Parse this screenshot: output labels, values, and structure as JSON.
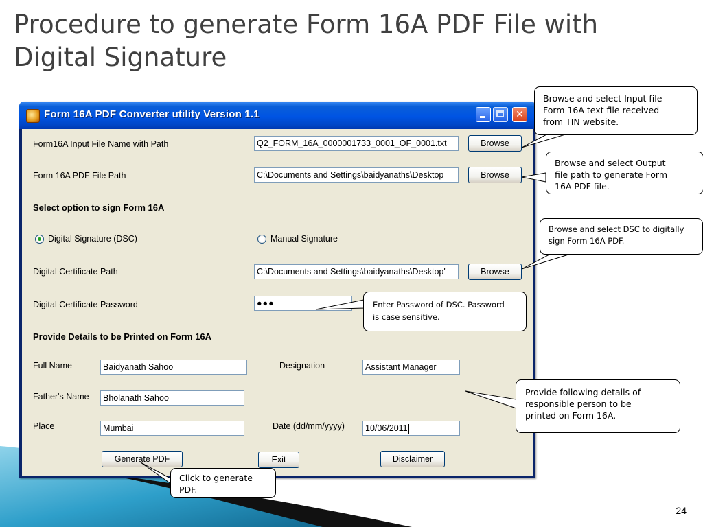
{
  "slide": {
    "title": "Procedure to generate Form 16A PDF File with Digital Signature",
    "page_number": "24"
  },
  "window": {
    "title": "Form 16A PDF Converter utility Version 1.1",
    "input_file": {
      "label": "Form16A Input File Name with Path",
      "value": "Q2_FORM_16A_0000001733_0001_OF_0001.txt",
      "browse": "Browse"
    },
    "pdf_path": {
      "label": "Form 16A PDF File Path",
      "value": "C:\\Documents and Settings\\baidyanaths\\Desktop",
      "browse": "Browse"
    },
    "sign_section": {
      "heading": "Select option to sign Form 16A",
      "option_dsc": "Digital Signature (DSC)",
      "option_manual": "Manual Signature",
      "selected": "Digital Signature (DSC)"
    },
    "cert_path": {
      "label": "Digital Certificate Path",
      "value": "C:\\Documents and Settings\\baidyanaths\\Desktop'",
      "browse": "Browse"
    },
    "cert_password": {
      "label": "Digital Certificate Password",
      "value": "●●●"
    },
    "details": {
      "heading": "Provide Details to be Printed on Form 16A",
      "full_name_label": "Full Name",
      "full_name": "Baidyanath Sahoo",
      "designation_label": "Designation",
      "designation": "Assistant Manager",
      "father_label": "Father's Name",
      "father": "Bholanath Sahoo",
      "place_label": "Place",
      "place": "Mumbai",
      "date_label": "Date (dd/mm/yyyy)",
      "date": "10/06/2011"
    },
    "buttons": {
      "generate": "Generate PDF",
      "exit": "Exit",
      "disclaimer": "Disclaimer"
    }
  },
  "callouts": {
    "input": [
      "Browse and select Input file",
      "Form 16A text file received",
      "from TIN website."
    ],
    "output": [
      "Browse and select Output",
      "file path to generate Form",
      "16A PDF file."
    ],
    "dsc": [
      "Browse and select DSC to digitally",
      "sign Form 16A PDF."
    ],
    "password": [
      "Enter Password of DSC. Password",
      "is case sensitive."
    ],
    "details": [
      "Provide following details of",
      "responsible person to be",
      "printed on Form 16A."
    ],
    "generate": [
      "Click to generate",
      "PDF."
    ]
  },
  "colors": {
    "titlebar": "#0054e3",
    "window_bg": "#ece9d8",
    "title_text": "#404040",
    "radio_selected": "#21a121"
  }
}
